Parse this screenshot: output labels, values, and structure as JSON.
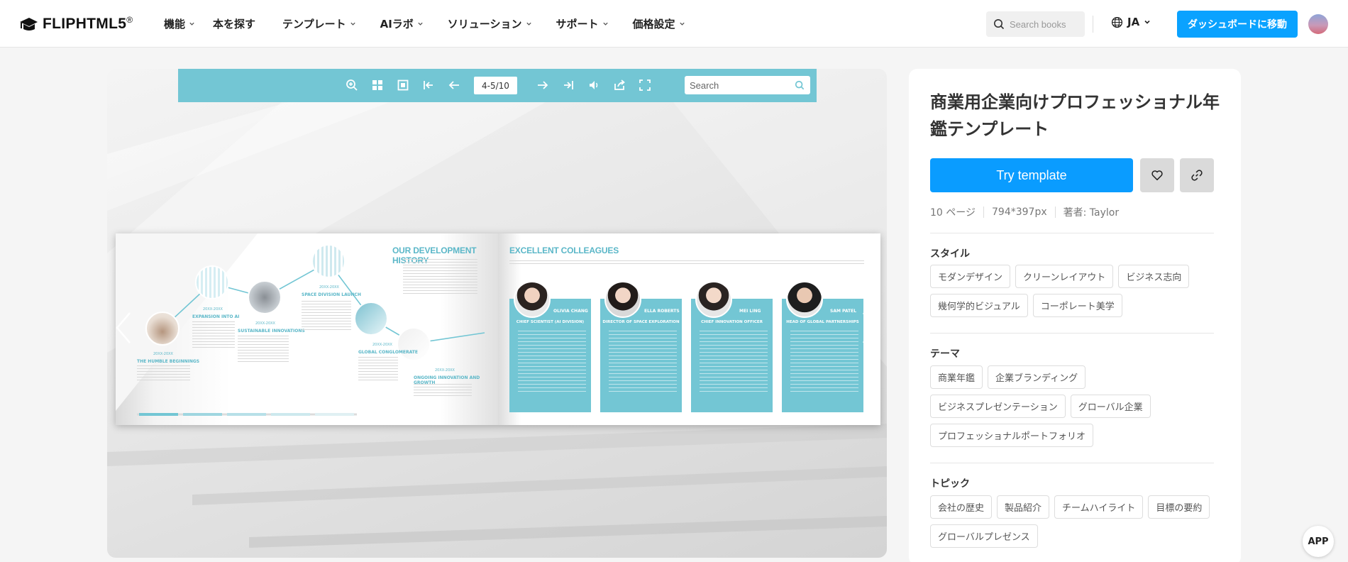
{
  "header": {
    "logo_text": "FLIPHTML5",
    "logo_reg": "®",
    "nav": [
      {
        "label": "機能",
        "has_menu": true
      },
      {
        "label": "本を探す",
        "has_menu": false
      },
      {
        "label": "テンプレート",
        "has_menu": true
      },
      {
        "label": "AIラボ",
        "has_menu": true
      },
      {
        "label": "ソリューション",
        "has_menu": true
      },
      {
        "label": "サポート",
        "has_menu": true
      },
      {
        "label": "価格設定",
        "has_menu": true
      }
    ],
    "search_placeholder": "Search books",
    "language": "JA",
    "dashboard_label": "ダッシュボードに移動"
  },
  "viewer": {
    "page_indicator": "4-5/10",
    "search_placeholder": "Search",
    "toolbar_icons": [
      "zoom-in-icon",
      "thumbnails-icon",
      "single-page-icon",
      "first-page-icon",
      "prev-page-icon",
      "next-page-icon",
      "last-page-icon",
      "sound-icon",
      "share-icon",
      "fullscreen-icon"
    ],
    "left_page": {
      "title": "OUR DEVELOPMENT HISTORY",
      "milestones": [
        {
          "label": "THE HUMBLE BEGINNINGS",
          "year": "20XX-20XX"
        },
        {
          "label": "EXPANSION INTO AI",
          "year": "20XX-20XX"
        },
        {
          "label": "SUSTAINABLE INNOVATIONS",
          "year": "20XX-20XX"
        },
        {
          "label": "SPACE DIVISION LAUNCH",
          "year": "20XX-20XX"
        },
        {
          "label": "GLOBAL CONGLOMERATE",
          "year": "20XX-20XX"
        },
        {
          "label": "ONGOING INNOVATION AND GROWTH",
          "year": "20XX-20XX"
        }
      ]
    },
    "right_page": {
      "title": "EXCELLENT COLLEAGUES",
      "colleagues": [
        {
          "name": "OLIVIA CHANG",
          "role": "CHIEF SCIENTIST (AI DIVISION)"
        },
        {
          "name": "ELLA ROBERTS",
          "role": "DIRECTOR OF SPACE EXPLORATION"
        },
        {
          "name": "MEI LING",
          "role": "CHIEF INNOVATION OFFICER"
        },
        {
          "name": "SAM PATEL",
          "role": "HEAD OF GLOBAL PARTNERSHIPS"
        }
      ]
    },
    "app_label": "APP"
  },
  "panel": {
    "title": "商業用企業向けプロフェッショナル年鑑テンプレート",
    "try_label": "Try template",
    "meta": {
      "pages": "10 ページ",
      "size": "794*397px",
      "author": "著者: Taylor"
    },
    "sections": [
      {
        "title": "スタイル",
        "tags": [
          "モダンデザイン",
          "クリーンレイアウト",
          "ビジネス志向",
          "幾何学的ビジュアル",
          "コーポレート美学"
        ]
      },
      {
        "title": "テーマ",
        "tags": [
          "商業年鑑",
          "企業ブランディング",
          "ビジネスプレゼンテーション",
          "グローバル企業",
          "プロフェッショナルポートフォリオ"
        ]
      },
      {
        "title": "トピック",
        "tags": [
          "会社の歴史",
          "製品紹介",
          "チームハイライト",
          "目標の要約",
          "グローバルプレゼンス"
        ]
      }
    ]
  },
  "colors": {
    "accent": "#0aa2ff",
    "teal": "#73c6d4",
    "try_button": "#0a9cff"
  }
}
